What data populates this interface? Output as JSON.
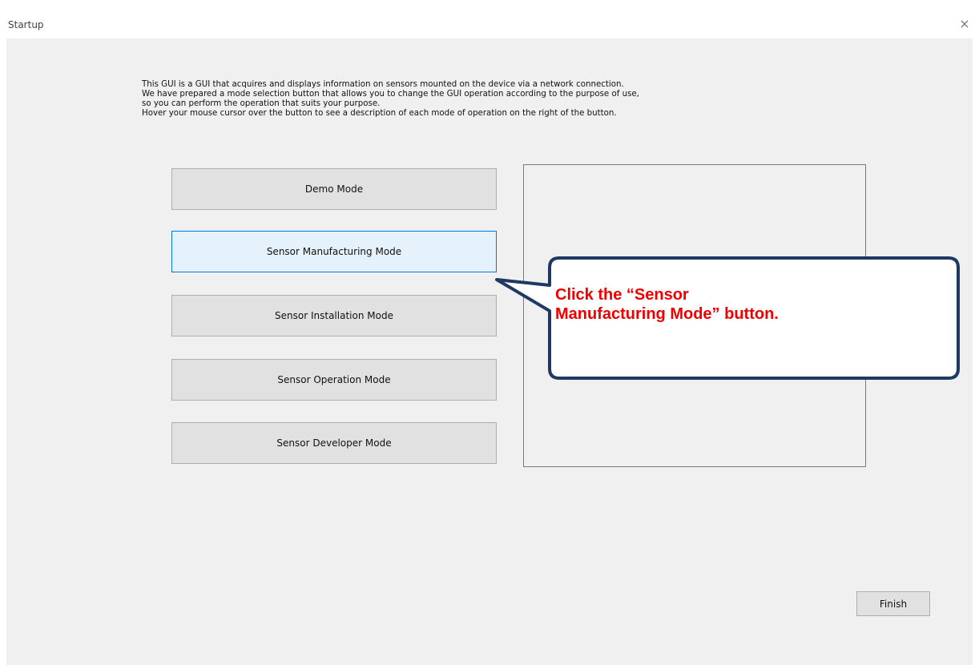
{
  "window": {
    "title": "Startup",
    "close_glyph": "×"
  },
  "description": {
    "lines": [
      "This GUI is a GUI that acquires and displays information on sensors mounted on the device via a network connection.",
      "We have prepared a mode selection button that allows you to change the GUI operation according to the purpose of use,",
      "so you can perform the operation that suits your purpose.",
      "Hover your mouse cursor over the button to see a description of each mode of operation on the right of the button."
    ]
  },
  "modes": [
    {
      "label": "Demo Mode"
    },
    {
      "label": "Sensor Manufacturing Mode"
    },
    {
      "label": "Sensor Installation Mode"
    },
    {
      "label": "Sensor Operation Mode"
    },
    {
      "label": "Sensor Developer Mode"
    }
  ],
  "finish_label": "Finish",
  "callout": {
    "text": "Click the “Sensor Manufacturing Mode” button.",
    "text_color": "#ee0000",
    "border_color": "#1f3864"
  }
}
